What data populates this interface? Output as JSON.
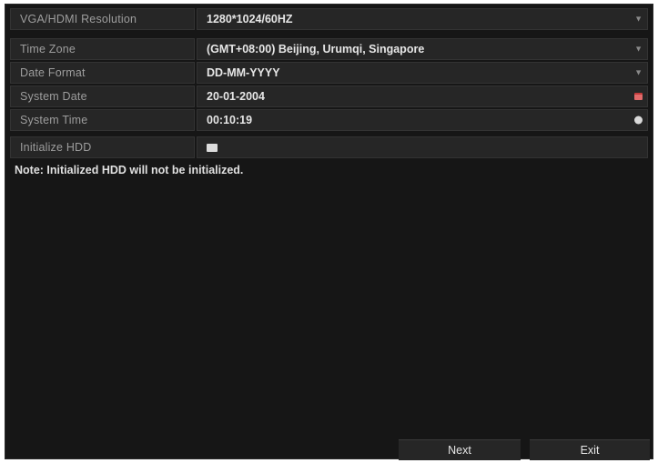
{
  "resolution": {
    "label": "VGA/HDMI Resolution",
    "value": "1280*1024/60HZ",
    "icon": "chevron-down-icon"
  },
  "time_zone": {
    "label": "Time Zone",
    "value": "(GMT+08:00) Beijing, Urumqi, Singapore",
    "icon": "chevron-down-icon"
  },
  "date_format": {
    "label": "Date Format",
    "value": "DD-MM-YYYY",
    "icon": "chevron-down-icon"
  },
  "system_date": {
    "label": "System Date",
    "value": "20-01-2004",
    "icon": "calendar-icon"
  },
  "system_time": {
    "label": "System Time",
    "value": "00:10:19",
    "icon": "clock-icon"
  },
  "initialize_hdd": {
    "label": "Initialize HDD",
    "checked": false
  },
  "note": "Note: Initialized HDD will not be initialized.",
  "buttons": {
    "next": "Next",
    "exit": "Exit"
  },
  "colors": {
    "background": "#161616",
    "field_background": "#262626",
    "label_text": "#9d9d9d",
    "value_text": "#e6e6e6"
  }
}
